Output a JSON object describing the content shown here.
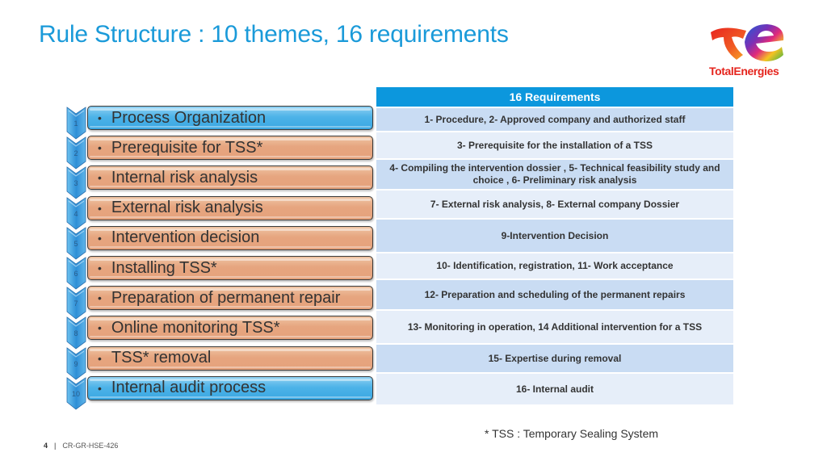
{
  "slide": {
    "title": "Rule Structure : 10 themes, 16 requirements",
    "logo": {
      "name": "TotalEnergies",
      "text": "TotalEnergies",
      "text_color": "#e5251e"
    },
    "accent_color": "#1a9ad9"
  },
  "themes": [
    {
      "number": "1",
      "label": "Process Organization",
      "color": "blue"
    },
    {
      "number": "2",
      "label": "Prerequisite for TSS*",
      "color": "orange"
    },
    {
      "number": "3",
      "label": "Internal risk analysis",
      "color": "orange"
    },
    {
      "number": "4",
      "label": "External risk analysis",
      "color": "orange"
    },
    {
      "number": "5",
      "label": "Intervention decision",
      "color": "orange"
    },
    {
      "number": "6",
      "label": "Installing TSS*",
      "color": "orange"
    },
    {
      "number": "7",
      "label": "Preparation of permanent repair",
      "color": "orange"
    },
    {
      "number": "8",
      "label": "Online monitoring TSS*",
      "color": "orange"
    },
    {
      "number": "9",
      "label": "TSS* removal",
      "color": "orange"
    },
    {
      "number": "10",
      "label": "Internal audit process",
      "color": "blue"
    }
  ],
  "requirements": {
    "header": "16 Requirements",
    "rows": [
      "1- Procedure, 2- Approved company and authorized staff",
      "3- Prerequisite for the installation of a TSS",
      "4- Compiling the intervention dossier , 5- Technical feasibility study and choice , 6- Preliminary risk analysis",
      "7- External risk analysis, 8- External company Dossier",
      "9-Intervention Decision",
      "10- Identification, registration, 11- Work acceptance",
      "12- Preparation and scheduling of the permanent repairs",
      "13- Monitoring in operation, 14 Additional intervention for a TSS",
      "15- Expertise during removal",
      "16- Internal audit"
    ]
  },
  "footnote": "* TSS : Temporary Sealing System",
  "footer": {
    "page_number": "4",
    "separator": "|",
    "doc_ref": "CR-GR-HSE-426"
  }
}
